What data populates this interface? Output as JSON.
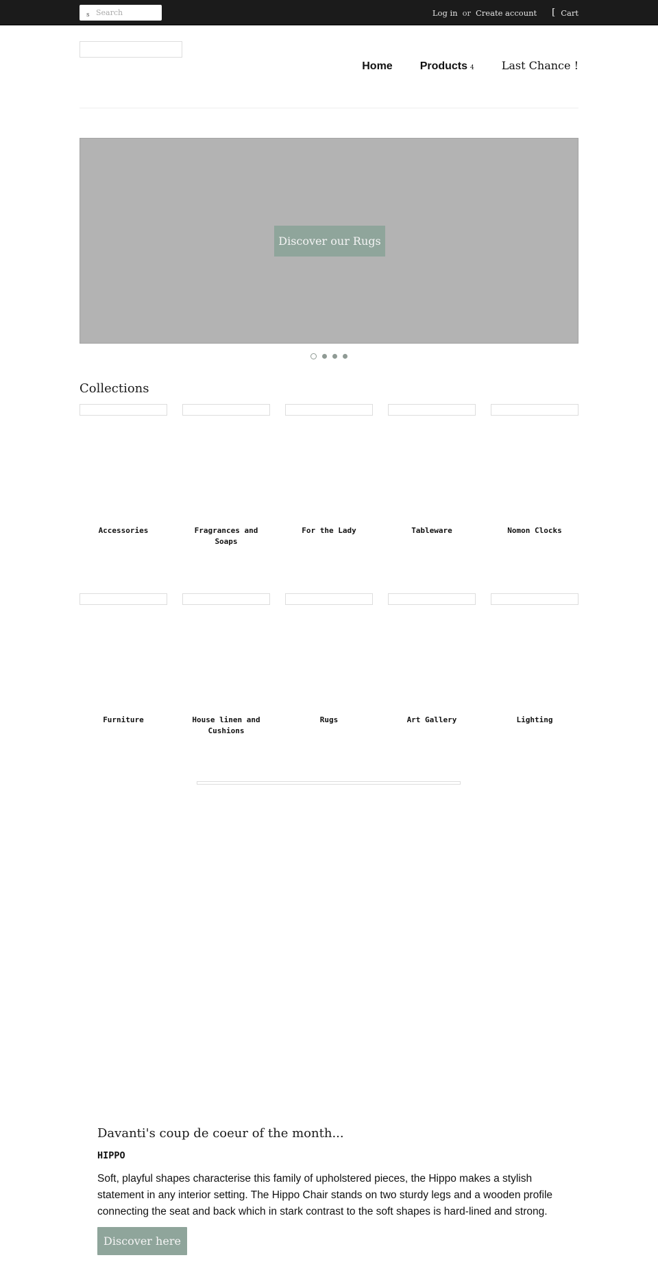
{
  "topbar": {
    "search": {
      "icon": "s",
      "placeholder": "Search",
      "value": ""
    },
    "login_label": "Log in",
    "or_label": "or",
    "create_account_label": "Create account",
    "cart_icon": "[",
    "cart_label": "Cart"
  },
  "header": {
    "nav": [
      {
        "label": "Home"
      },
      {
        "label": "Products",
        "badge": "4"
      },
      {
        "label": "Last Chance !"
      }
    ]
  },
  "slideshow": {
    "button_label": "Discover our Rugs",
    "slide_count": 4,
    "active_slide": 1
  },
  "collections": {
    "title": "Collections",
    "items": [
      {
        "label": "Accessories"
      },
      {
        "label": "Fragrances and Soaps"
      },
      {
        "label": "For the Lady"
      },
      {
        "label": "Tableware"
      },
      {
        "label": "Nomon Clocks"
      },
      {
        "label": "Furniture"
      },
      {
        "label": "House linen and Cushions"
      },
      {
        "label": "Rugs"
      },
      {
        "label": "Art Gallery"
      },
      {
        "label": "Lighting"
      }
    ]
  },
  "featured": {
    "title": "Davanti's coup de coeur of the month...",
    "subtitle": "HIPPO",
    "body": "Soft, playful shapes characterise this family of upholstered pieces, the Hippo makes a stylish statement in any interior setting. The Hippo Chair stands on two sturdy legs and a wooden profile connecting the seat and back which in stark contrast to the soft shapes is hard-lined and strong.",
    "button_label": "Discover here"
  },
  "colors": {
    "topbar_bg": "#1b1b1b",
    "accent_button": "#8fa59b",
    "slide_bg": "#b3b3b3"
  }
}
